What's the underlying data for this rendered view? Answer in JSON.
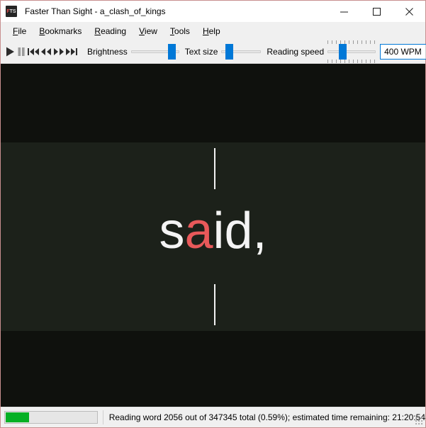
{
  "window": {
    "title": "Faster Than Sight - a_clash_of_kings",
    "icon_text_f": "F",
    "icon_text_ts": "TS",
    "icon_name": "fts-app-icon",
    "controls": {
      "minimize": "minimize-icon",
      "maximize": "maximize-icon",
      "close": "close-icon"
    }
  },
  "menubar": {
    "items": [
      {
        "label": "File",
        "mnemonic": "F",
        "rest": "ile"
      },
      {
        "label": "Bookmarks",
        "mnemonic": "B",
        "rest": "ookmarks"
      },
      {
        "label": "Reading",
        "mnemonic": "R",
        "rest": "eading"
      },
      {
        "label": "View",
        "mnemonic": "V",
        "rest": "iew"
      },
      {
        "label": "Tools",
        "mnemonic": "T",
        "rest": "ools"
      },
      {
        "label": "Help",
        "mnemonic": "H",
        "rest": "elp"
      }
    ]
  },
  "toolbar": {
    "buttons": [
      {
        "name": "play-icon",
        "label": "Play"
      },
      {
        "name": "pause-icon",
        "label": "Pause"
      },
      {
        "name": "skip-backward-icon",
        "label": "Skip backward"
      },
      {
        "name": "rewind-icon",
        "label": "Rewind"
      },
      {
        "name": "fast-forward-icon",
        "label": "Fast forward"
      },
      {
        "name": "skip-forward-icon",
        "label": "Skip forward"
      }
    ],
    "brightness_label": "Brightness",
    "text_size_label": "Text size",
    "reading_speed_label": "Reading speed",
    "speed_value": "400 WPM",
    "accent_color": "#0078d7"
  },
  "reading": {
    "word_prefix": "s",
    "word_focus": "a",
    "word_suffix": "id,",
    "focus_color": "#e8595a",
    "text_color": "#f4f4f4",
    "background_dim": "#0f110d",
    "background_focus_band": "#1c211a",
    "guide_color": "#f2f2f2"
  },
  "statusbar": {
    "progress_percent": "0.59%",
    "status_text": "Reading word 2056 out of 347345 total (0.59%); estimated time remaining: 21:20:54",
    "progress_color": "#06b025"
  }
}
